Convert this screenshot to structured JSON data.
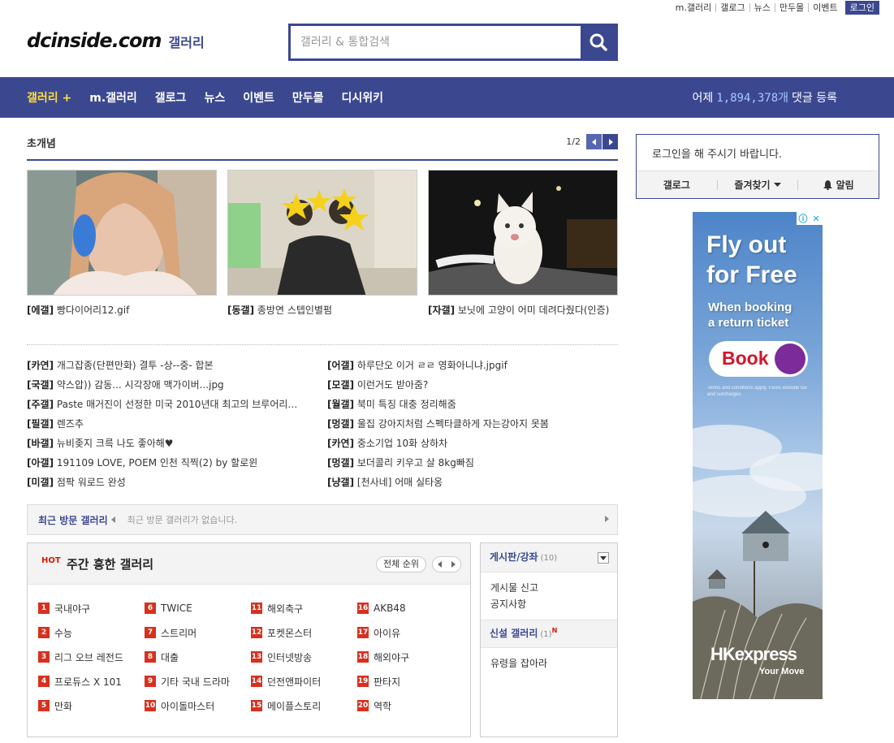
{
  "util": {
    "items": [
      "m.갤러리",
      "갤로그",
      "뉴스",
      "만두몰",
      "이벤트"
    ],
    "login": "로그인"
  },
  "header": {
    "logo": "dcinside.com",
    "logo_sub": "갤러리",
    "search_placeholder": "갤러리 & 통합검색"
  },
  "nav": {
    "items": [
      "갤러리 +",
      "m.갤러리",
      "갤로그",
      "뉴스",
      "이벤트",
      "만두몰",
      "디시위키"
    ],
    "stat_prefix": "어제",
    "stat_num": "1,894,378개",
    "stat_suffix": "댓글 등록"
  },
  "concept": {
    "title": "초개념",
    "page": "1/2",
    "thumbs": [
      {
        "tag": "[에갤]",
        "text": "빵다이어리12.gif"
      },
      {
        "tag": "[동갤]",
        "text": "종방연 스텝인별펌"
      },
      {
        "tag": "[자갤]",
        "text": "보닛에 고양이 어미 데려다줬다(인증)"
      }
    ],
    "left_list": [
      {
        "tag": "[카연]",
        "text": "개그잡종(단편만화) 결투 -상--중- 합본"
      },
      {
        "tag": "[국갤]",
        "text": "약스압)) 감동... 시각장애 맥가이버...jpg"
      },
      {
        "tag": "[주갤]",
        "text": "Paste 매거진이 선정한 미국 2010년대 최고의 브루어리…"
      },
      {
        "tag": "[필갤]",
        "text": "렌즈추"
      },
      {
        "tag": "[바갤]",
        "text": "뉴비좆지 크륵 나도 좋아해♥"
      },
      {
        "tag": "[아갤]",
        "text": "191109 LOVE, POEM 인천 직찍(2) by 할로윈"
      },
      {
        "tag": "[미갤]",
        "text": "점팍 워로드 완성"
      }
    ],
    "right_list": [
      {
        "tag": "[어갤]",
        "text": "하루단오 이거 ㄹㄹ 영화아니냐.jpgif"
      },
      {
        "tag": "[모갤]",
        "text": "이런거도 받아줌?"
      },
      {
        "tag": "[월갤]",
        "text": "북미 특징 대충 정리해줌"
      },
      {
        "tag": "[멍갤]",
        "text": "울집 강아지처럼 스펙타클하게 자는강아지 못봄"
      },
      {
        "tag": "[카연]",
        "text": "중소기업 10화 상하차"
      },
      {
        "tag": "[멍갤]",
        "text": "보더콜리 키우고 살 8kg빠짐"
      },
      {
        "tag": "[냥갤]",
        "text": "[천사네] 어매 실타옹"
      }
    ]
  },
  "recent": {
    "title": "최근 방문 갤러리",
    "empty": "최근 방문 갤러리가 없습니다."
  },
  "hot": {
    "badge": "HOT",
    "title": "주간 흥한 갤러리",
    "rank_button": "전체 순위",
    "items": [
      {
        "n": "1",
        "name": "국내야구"
      },
      {
        "n": "2",
        "name": "수능"
      },
      {
        "n": "3",
        "name": "리그 오브 레전드"
      },
      {
        "n": "4",
        "name": "프로듀스 X 101"
      },
      {
        "n": "5",
        "name": "만화"
      },
      {
        "n": "6",
        "name": "TWICE"
      },
      {
        "n": "7",
        "name": "스트리머"
      },
      {
        "n": "8",
        "name": "대출"
      },
      {
        "n": "9",
        "name": "기타 국내 드라마"
      },
      {
        "n": "10",
        "name": "아이돌마스터"
      },
      {
        "n": "11",
        "name": "해외축구"
      },
      {
        "n": "12",
        "name": "포켓몬스터"
      },
      {
        "n": "13",
        "name": "인터넷방송"
      },
      {
        "n": "14",
        "name": "던전앤파이터"
      },
      {
        "n": "15",
        "name": "메이플스토리"
      },
      {
        "n": "16",
        "name": "AKB48"
      },
      {
        "n": "17",
        "name": "아이유"
      },
      {
        "n": "18",
        "name": "해외야구"
      },
      {
        "n": "19",
        "name": "판타지"
      },
      {
        "n": "20",
        "name": "역학"
      }
    ]
  },
  "board": {
    "title": "게시판/강좌",
    "count": "(10)",
    "items": [
      "게시물 신고",
      "공지사항"
    ],
    "new_title": "신설 갤러리",
    "new_count": "(1)",
    "new_badge": "N",
    "new_items": [
      "유령을 잡아라"
    ]
  },
  "login": {
    "message": "로그인을 해 주시기 바랍니다.",
    "buttons": [
      "갤로그",
      "즐겨찾기",
      "알림"
    ]
  },
  "ad": {
    "headline_1": "Fly out",
    "headline_2": "for Free",
    "sub_1": "When booking",
    "sub_2": "a return ticket",
    "button": "Book",
    "terms": "Terms and conditions apply. Fares exclude tax and surcharges.",
    "brand": "HKexpress",
    "brand_sub": "Your Move"
  },
  "colors": {
    "brand": "#3b4890",
    "accent": "#ffdd3b",
    "hot": "#d7311e"
  }
}
